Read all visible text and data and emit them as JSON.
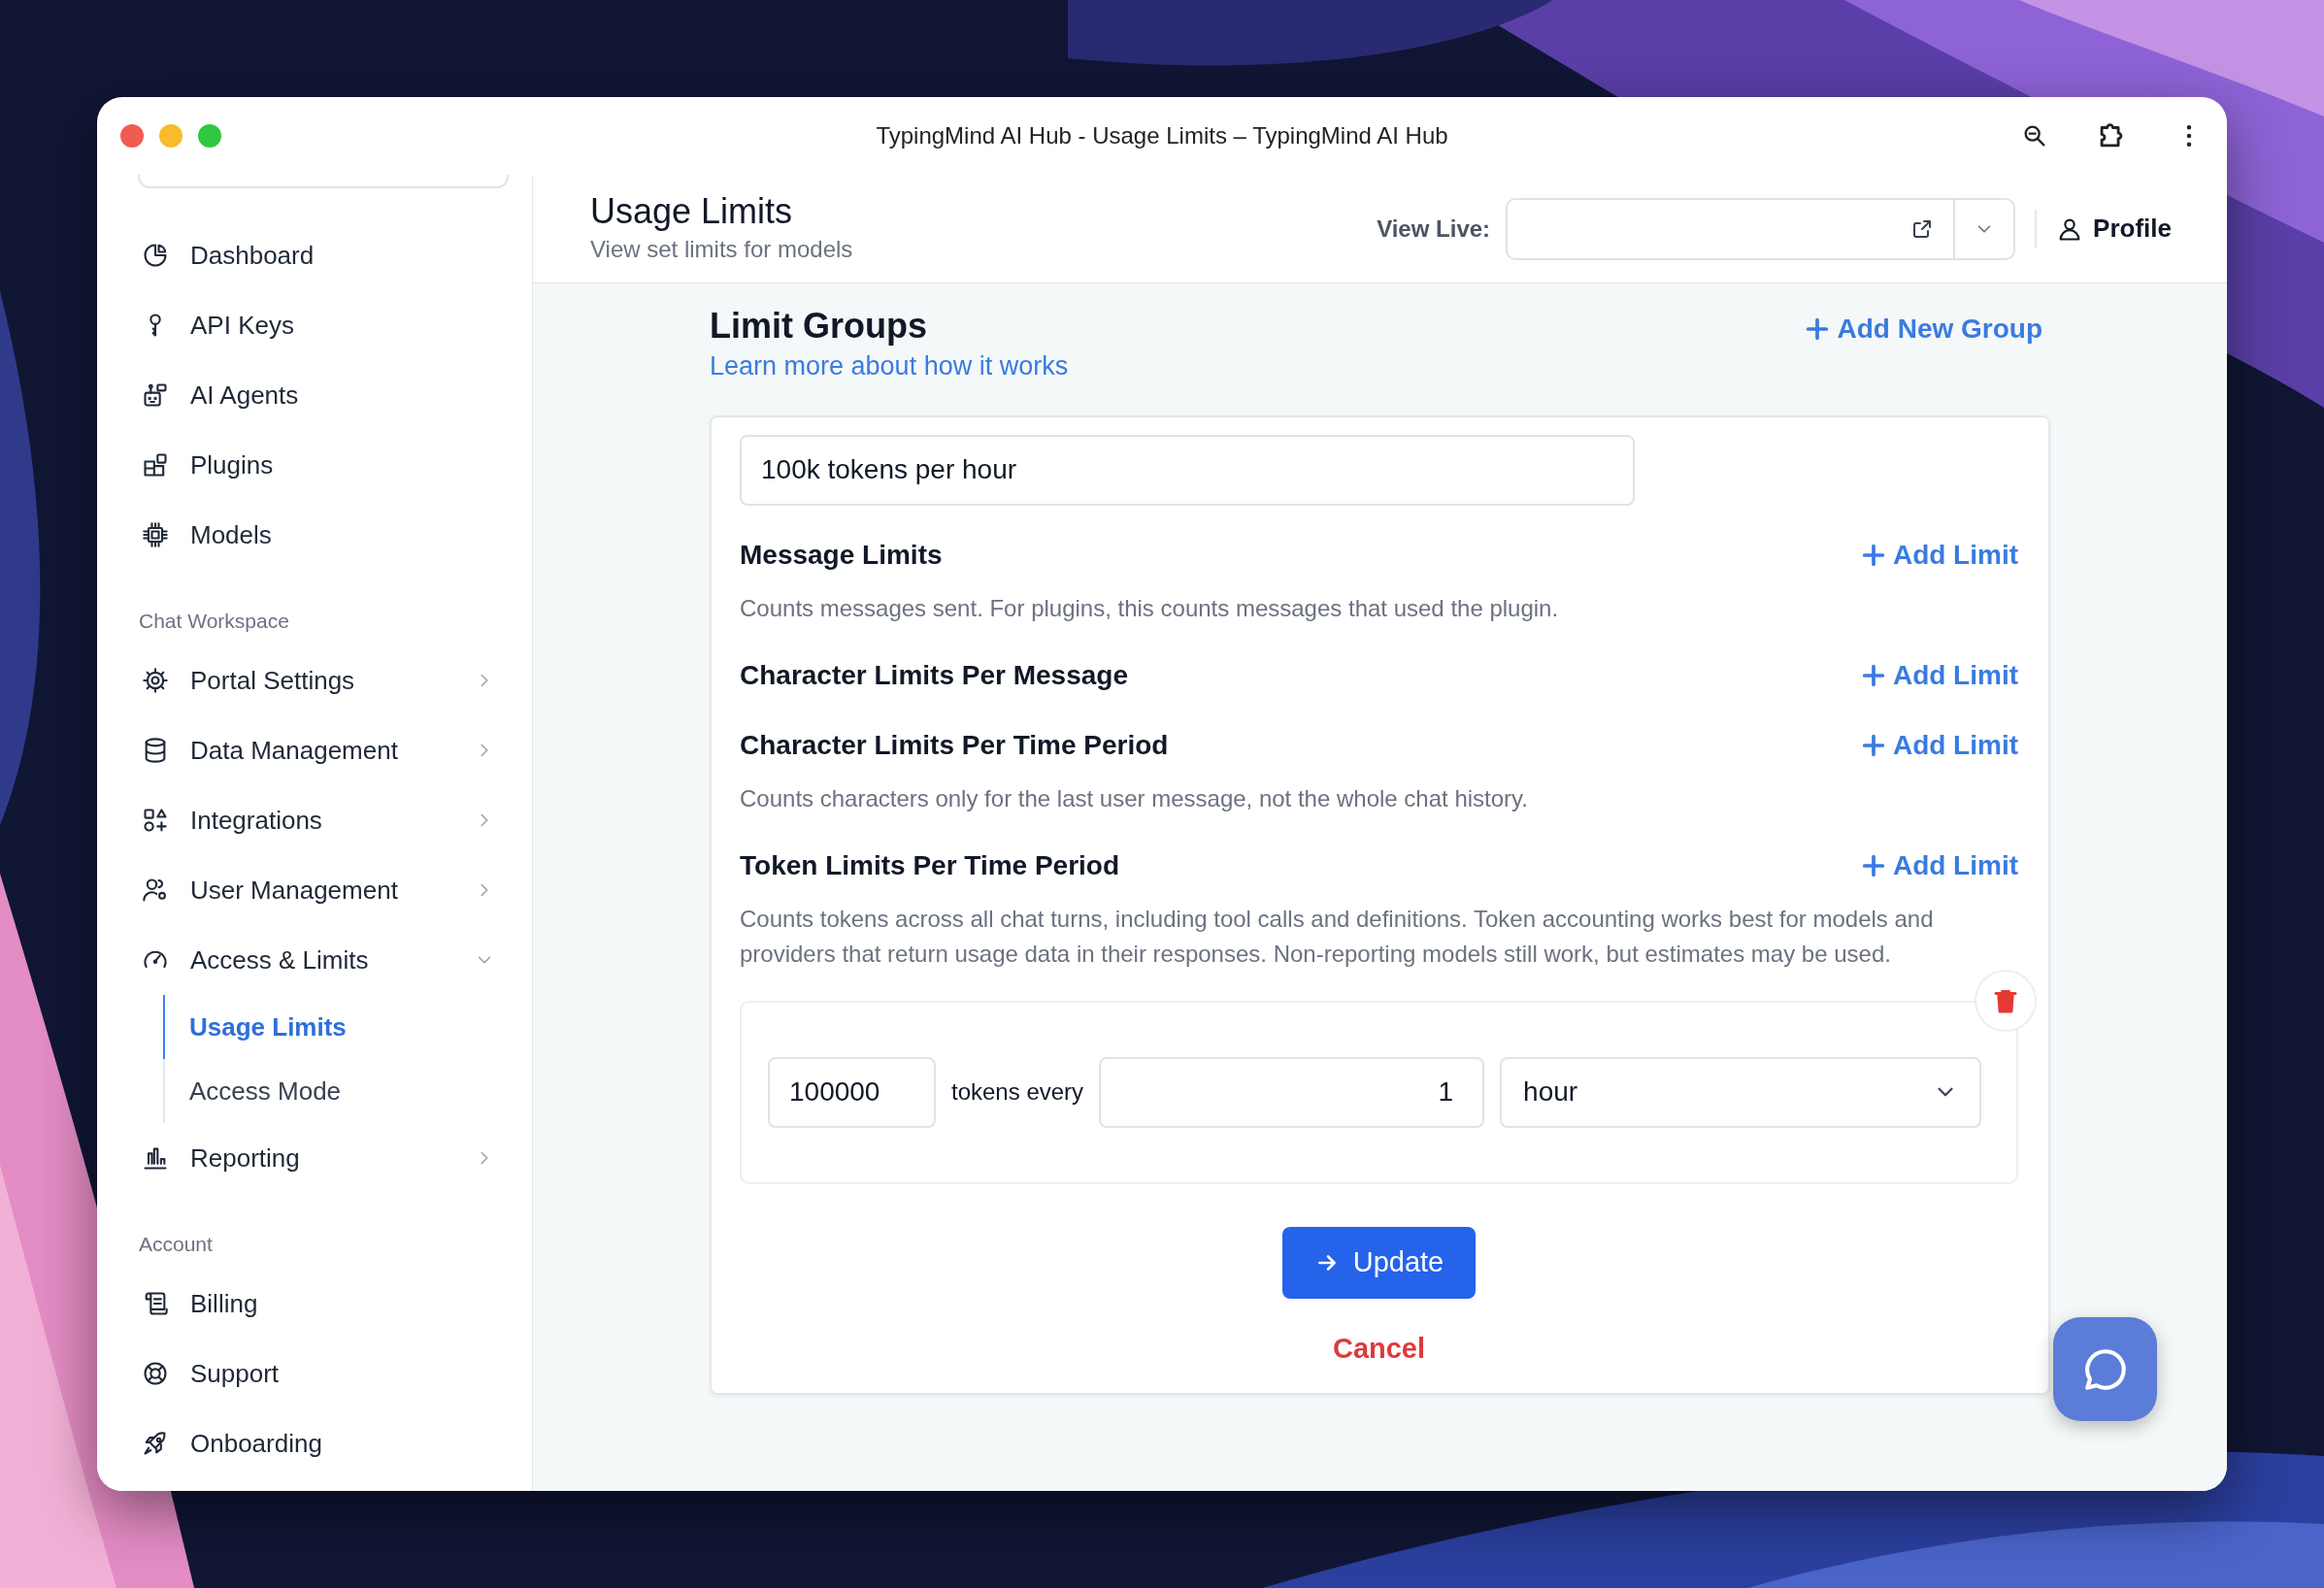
{
  "window": {
    "title": "TypingMind AI Hub - Usage Limits – TypingMind AI Hub"
  },
  "sidebar": {
    "groups": [
      {
        "items": [
          {
            "label": "Dashboard"
          },
          {
            "label": "API Keys"
          },
          {
            "label": "AI Agents"
          },
          {
            "label": "Plugins"
          },
          {
            "label": "Models"
          }
        ]
      },
      {
        "heading": "Chat Workspace",
        "items": [
          {
            "label": "Portal Settings",
            "expanded": false
          },
          {
            "label": "Data Management",
            "expanded": false
          },
          {
            "label": "Integrations",
            "expanded": false
          },
          {
            "label": "User Management",
            "expanded": false
          },
          {
            "label": "Access & Limits",
            "expanded": true,
            "children": [
              {
                "label": "Usage Limits",
                "selected": true
              },
              {
                "label": "Access Mode",
                "selected": false
              }
            ]
          },
          {
            "label": "Reporting",
            "expanded": false
          }
        ]
      },
      {
        "heading": "Account",
        "items": [
          {
            "label": "Billing"
          },
          {
            "label": "Support"
          },
          {
            "label": "Onboarding"
          }
        ]
      }
    ]
  },
  "header": {
    "title": "Usage Limits",
    "subtitle": "View set limits for models",
    "view_live_label": "View Live:",
    "profile": "Profile"
  },
  "limit_groups": {
    "title": "Limit Groups",
    "learn_more": "Learn more about how it works",
    "add_group": "Add New Group"
  },
  "group": {
    "name": "100k tokens per hour",
    "sections": [
      {
        "title": "Message Limits",
        "action": "Add Limit",
        "description": "Counts messages sent. For plugins, this counts messages that used the plugin."
      },
      {
        "title": "Character Limits Per Message",
        "action": "Add Limit"
      },
      {
        "title": "Character Limits Per Time Period",
        "action": "Add Limit",
        "description": "Counts characters only for the last user message, not the whole chat history."
      },
      {
        "title": "Token Limits Per Time Period",
        "action": "Add Limit",
        "description": "Counts tokens across all chat turns, including tool calls and definitions. Token accounting works best for models and providers that return usage data in their responses. Non-reporting models still work, but estimates may be used."
      }
    ],
    "limits": [
      {
        "amount": "100000",
        "unit_label": "tokens every",
        "period_count": "1",
        "period": "hour"
      }
    ],
    "update": "Update",
    "cancel": "Cancel"
  }
}
